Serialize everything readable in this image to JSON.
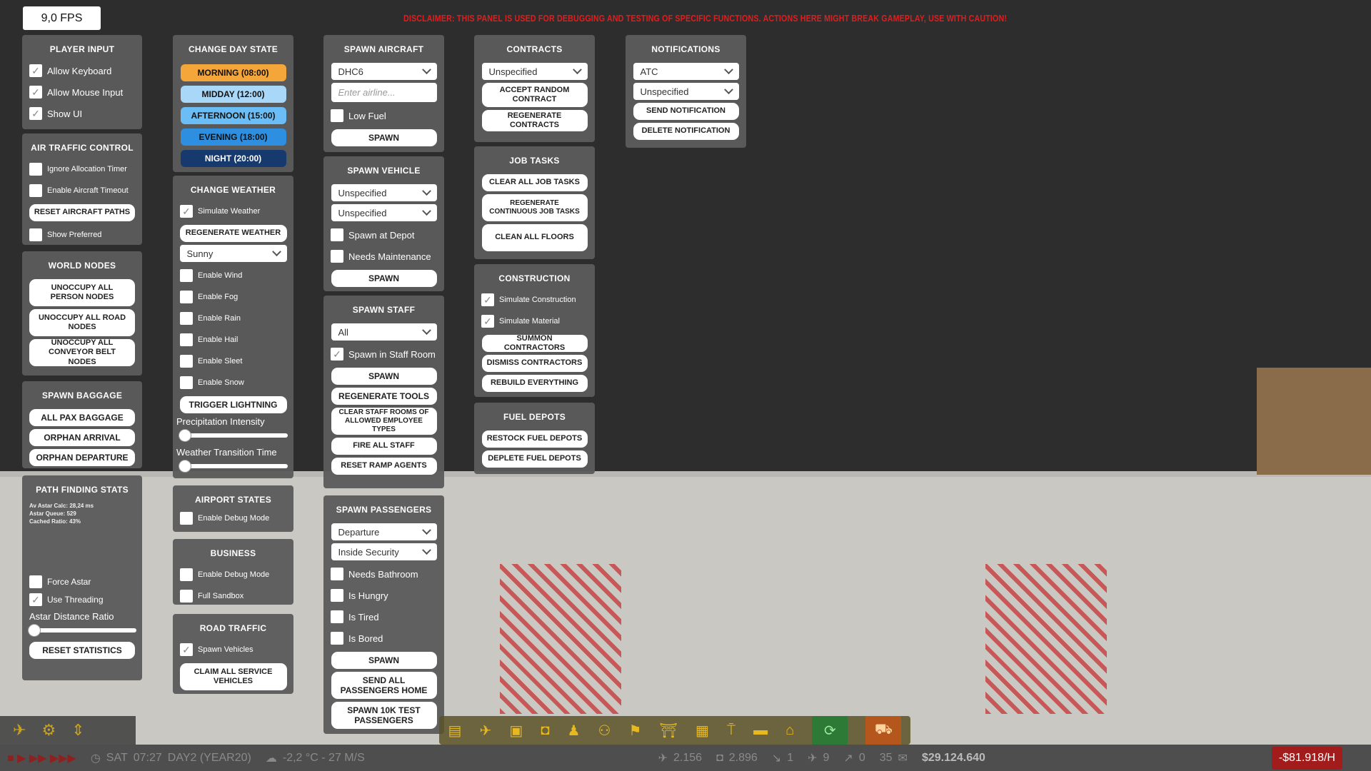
{
  "fps": "9,0 FPS",
  "disclaimer": "DISCLAIMER: THIS PANEL IS USED FOR DEBUGGING AND TESTING OF SPECIFIC FUNCTIONS. ACTIONS HERE MIGHT BREAK GAMEPLAY, USE WITH CAUTION!",
  "player_input": {
    "title": "PLAYER INPUT",
    "items": [
      {
        "label": "Allow Keyboard",
        "checked": true
      },
      {
        "label": "Allow Mouse Input",
        "checked": true
      },
      {
        "label": "Show UI",
        "checked": true
      }
    ]
  },
  "atc": {
    "title": "AIR TRAFFIC CONTROL",
    "ignore_timer": "Ignore Allocation Timer",
    "enable_timeout": "Enable Aircraft Timeout",
    "reset_paths": "RESET AIRCRAFT PATHS",
    "show_preferred": "Show Preferred"
  },
  "world_nodes": {
    "title": "WORLD NODES",
    "unoccupy_person": "UNOCCUPY ALL PERSON NODES",
    "unoccupy_road": "UNOCCUPY ALL ROAD NODES",
    "unoccupy_conveyor": "UNOCCUPY ALL CONVEYOR BELT NODES"
  },
  "spawn_baggage": {
    "title": "SPAWN BAGGAGE",
    "all_pax": "ALL PAX BAGGAGE",
    "orphan_arrival": "ORPHAN ARRIVAL",
    "orphan_departure": "ORPHAN DEPARTURE"
  },
  "path_stats": {
    "title": "PATH FINDING STATS",
    "lines": [
      "Av Astar Calc: 28,24 ms",
      "Astar Queue: 529",
      "Cached Ratio: 43%"
    ],
    "force_astar": "Force Astar",
    "use_threading": "Use Threading",
    "distance_ratio": "Astar Distance Ratio",
    "distance_ratio_value": 0.0,
    "reset_stats": "RESET STATISTICS"
  },
  "day_state": {
    "title": "CHANGE DAY STATE",
    "buttons": [
      {
        "label": "MORNING  (08:00)",
        "color": "#f5a63b"
      },
      {
        "label": "MIDDAY  (12:00)",
        "color": "#a9d7f7"
      },
      {
        "label": "AFTERNOON  (15:00)",
        "color": "#6bbef5"
      },
      {
        "label": "EVENING  (18:00)",
        "color": "#2e8fe0"
      },
      {
        "label": "NIGHT (20:00)",
        "color": "#173a6e"
      }
    ]
  },
  "weather": {
    "title": "CHANGE WEATHER",
    "simulate": "Simulate Weather",
    "regenerate": "REGENERATE WEATHER",
    "selected": "Sunny",
    "toggles": [
      "Enable Wind",
      "Enable Fog",
      "Enable Rain",
      "Enable Hail",
      "Enable Sleet",
      "Enable Snow"
    ],
    "lightning": "TRIGGER LIGHTNING",
    "precip": "Precipitation Intensity",
    "precip_value": 0.05,
    "transition": "Weather Transition Time",
    "transition_value": 0.0
  },
  "airport_states": {
    "title": "AIRPORT STATES",
    "debug": "Enable Debug Mode"
  },
  "business": {
    "title": "BUSINESS",
    "debug": "Enable Debug Mode",
    "sandbox": "Full Sandbox"
  },
  "road_traffic": {
    "title": "ROAD TRAFFIC",
    "spawn": "Spawn Vehicles",
    "claim": "CLAIM ALL SERVICE VEHICLES"
  },
  "spawn_aircraft": {
    "title": "SPAWN AIRCRAFT",
    "model": "DHC6",
    "airline_placeholder": "Enter airline...",
    "low_fuel": "Low Fuel",
    "spawn": "SPAWN"
  },
  "spawn_vehicle": {
    "title": "SPAWN VEHICLE",
    "select1": "Unspecified",
    "select2": "Unspecified",
    "at_depot": "Spawn at Depot",
    "maintenance": "Needs Maintenance",
    "spawn": "SPAWN"
  },
  "spawn_staff": {
    "title": "SPAWN STAFF",
    "select": "All",
    "in_staff_room": "Spawn in Staff Room",
    "spawn": "SPAWN",
    "regenerate_tools": "REGENERATE TOOLS",
    "clear_rooms": "CLEAR STAFF ROOMS OF ALLOWED EMPLOYEE TYPES",
    "fire_all": "FIRE ALL STAFF",
    "reset_ramp": "RESET RAMP AGENTS"
  },
  "spawn_passengers": {
    "title": "SPAWN PASSENGERS",
    "select1": "Departure",
    "select2": "Inside Security",
    "toggles": [
      "Needs Bathroom",
      "Is Hungry",
      "Is Tired",
      "Is Bored"
    ],
    "spawn": "SPAWN",
    "send_home": "SEND ALL PASSENGERS HOME",
    "spawn_10k": "SPAWN 10K TEST PASSENGERS"
  },
  "contracts": {
    "title": "CONTRACTS",
    "select": "Unspecified",
    "accept": "ACCEPT RANDOM CONTRACT",
    "regenerate": "REGENERATE CONTRACTS"
  },
  "job_tasks": {
    "title": "JOB TASKS",
    "clear": "CLEAR ALL JOB TASKS",
    "regenerate": "REGENERATE CONTINUOUS JOB TASKS",
    "clean": "CLEAN ALL FLOORS"
  },
  "construction": {
    "title": "CONSTRUCTION",
    "sim_construction": "Simulate Construction",
    "sim_material": "Simulate Material",
    "summon": "SUMMON CONTRACTORS",
    "dismiss": "DISMISS CONTRACTORS",
    "rebuild": "REBUILD EVERYTHING"
  },
  "fuel_depots": {
    "title": "FUEL DEPOTS",
    "restock": "RESTOCK FUEL DEPOTS",
    "deplete": "DEPLETE FUEL DEPOTS"
  },
  "notifications": {
    "title": "NOTIFICATIONS",
    "select1": "ATC",
    "select2": "Unspecified",
    "send": "SEND NOTIFICATION",
    "delete": "DELETE NOTIFICATION"
  },
  "bottom_bar": {
    "day": "SAT",
    "time": "07:27",
    "date": "DAY2 (YEAR20)",
    "weather": "-2,2 °C - 27 M/S",
    "stat1": "2.156",
    "stat2": "2.896",
    "stat3": "1",
    "stat4": "9",
    "stat5": "0",
    "mail": "35",
    "money": "$29.124.640",
    "rate": "-$81.918/H"
  }
}
